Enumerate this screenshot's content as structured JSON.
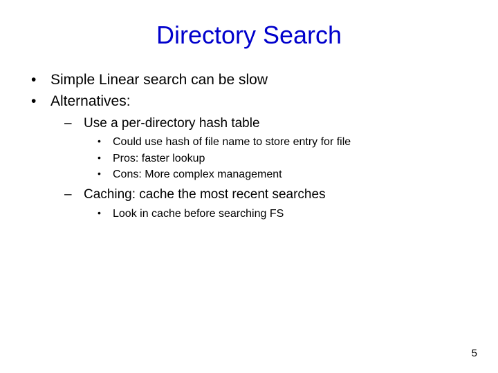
{
  "title": "Directory Search",
  "bullets": {
    "b1": "Simple Linear search can be slow",
    "b2": "Alternatives:",
    "b2_1": "Use a per-directory hash table",
    "b2_1_1": "Could use hash of file name to store entry for file",
    "b2_1_2": "Pros: faster lookup",
    "b2_1_3": "Cons: More complex management",
    "b2_2": "Caching: cache the most recent searches",
    "b2_2_1": "Look in cache before searching FS"
  },
  "page_number": "5"
}
